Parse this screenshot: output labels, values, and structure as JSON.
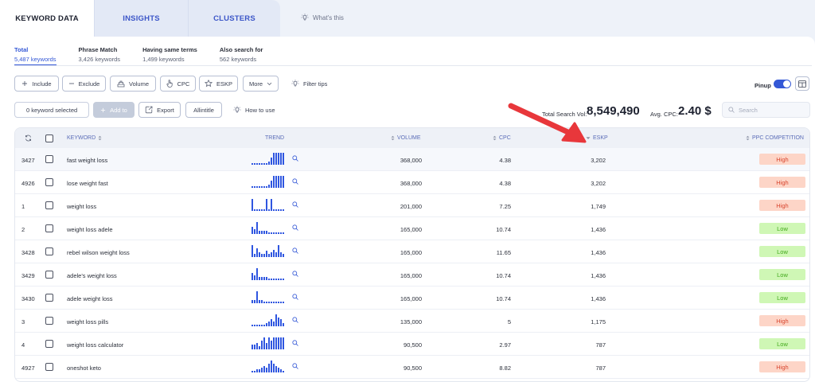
{
  "tabs": [
    {
      "label": "KEYWORD DATA"
    },
    {
      "label": "INSIGHTS"
    },
    {
      "label": "CLUSTERS"
    }
  ],
  "whats_this": "What's this",
  "subtabs": [
    {
      "title": "Total",
      "count": "5,487 keywords"
    },
    {
      "title": "Phrase Match",
      "count": "3,426 keywords"
    },
    {
      "title": "Having same terms",
      "count": "1,499 keywords"
    },
    {
      "title": "Also search for",
      "count": "562 keywords"
    }
  ],
  "filters": {
    "include": "Include",
    "exclude": "Exclude",
    "volume": "Volume",
    "cpc": "CPC",
    "eskp": "ESKP",
    "more": "More",
    "filter_tips": "Filter tips"
  },
  "pinup": {
    "label": "Pinup",
    "on": true
  },
  "actions": {
    "selected": "0 keyword selected",
    "add_to": "Add to",
    "export": "Export",
    "allintitle": "Allintitle",
    "how_to_use": "How to use"
  },
  "stats": {
    "total_label": "Total Search Vol:",
    "total_value": "8,549,490",
    "cpc_label": "Avg. CPC:",
    "cpc_value": "2.40 $"
  },
  "search": {
    "placeholder": "Search"
  },
  "table": {
    "headers": {
      "keyword": "KEYWORD",
      "trend": "TREND",
      "volume": "VOLUME",
      "cpc": "CPC",
      "eskp": "ESKP",
      "competition": "PPC COMPETITION"
    },
    "rows": [
      {
        "id": "3427",
        "keyword": "fast weight loss",
        "volume": "368,000",
        "cpc": "4.38",
        "eskp": "3,202",
        "competition": "High",
        "level": "high",
        "trend": [
          1,
          1,
          1,
          1,
          1,
          1,
          1,
          2,
          5,
          8,
          8,
          8,
          8,
          8
        ]
      },
      {
        "id": "4926",
        "keyword": "lose weight fast",
        "volume": "368,000",
        "cpc": "4.38",
        "eskp": "3,202",
        "competition": "High",
        "level": "high",
        "trend": [
          1,
          1,
          1,
          1,
          1,
          1,
          1,
          2,
          5,
          8,
          8,
          8,
          8,
          8
        ]
      },
      {
        "id": "1",
        "keyword": "weight loss",
        "volume": "201,000",
        "cpc": "7.25",
        "eskp": "1,749",
        "competition": "High",
        "level": "high",
        "trend": [
          8,
          1,
          1,
          1,
          1,
          1,
          8,
          1,
          8,
          1,
          1,
          1,
          1,
          1
        ]
      },
      {
        "id": "2",
        "keyword": "weight loss adele",
        "volume": "165,000",
        "cpc": "10.74",
        "eskp": "1,436",
        "competition": "Low",
        "level": "low",
        "trend": [
          5,
          3,
          8,
          2,
          2,
          2,
          2,
          1,
          1,
          1,
          1,
          1,
          1,
          1
        ]
      },
      {
        "id": "3428",
        "keyword": "rebel wilson weight loss",
        "volume": "165,000",
        "cpc": "11.65",
        "eskp": "1,436",
        "competition": "Low",
        "level": "low",
        "trend": [
          8,
          2,
          6,
          3,
          2,
          2,
          4,
          2,
          3,
          5,
          3,
          8,
          3,
          2
        ]
      },
      {
        "id": "3429",
        "keyword": "adele's weight loss",
        "volume": "165,000",
        "cpc": "10.74",
        "eskp": "1,436",
        "competition": "Low",
        "level": "low",
        "trend": [
          5,
          3,
          8,
          2,
          2,
          2,
          2,
          1,
          1,
          1,
          1,
          1,
          1,
          1
        ]
      },
      {
        "id": "3430",
        "keyword": "adele weight loss",
        "volume": "165,000",
        "cpc": "10.74",
        "eskp": "1,436",
        "competition": "Low",
        "level": "low",
        "trend": [
          2,
          2,
          8,
          2,
          2,
          1,
          1,
          1,
          1,
          1,
          1,
          1,
          1,
          1
        ]
      },
      {
        "id": "3",
        "keyword": "weight loss pills",
        "volume": "135,000",
        "cpc": "5",
        "eskp": "1,175",
        "competition": "High",
        "level": "high",
        "trend": [
          1,
          1,
          1,
          1,
          1,
          1,
          2,
          3,
          5,
          3,
          8,
          6,
          5,
          2
        ]
      },
      {
        "id": "4",
        "keyword": "weight loss calculator",
        "volume": "90,500",
        "cpc": "2.97",
        "eskp": "787",
        "competition": "Low",
        "level": "low",
        "trend": [
          3,
          3,
          4,
          2,
          6,
          8,
          4,
          8,
          6,
          8,
          8,
          8,
          8,
          8
        ]
      },
      {
        "id": "4927",
        "keyword": "oneshot keto",
        "volume": "90,500",
        "cpc": "8.82",
        "eskp": "787",
        "competition": "High",
        "level": "high",
        "trend": [
          1,
          1,
          2,
          2,
          3,
          4,
          3,
          6,
          8,
          6,
          4,
          3,
          2,
          1
        ]
      }
    ]
  },
  "colors": {
    "accent": "#3458d6",
    "high_bg": "#fdd5c7",
    "low_bg": "#cff7b5",
    "annotation_arrow": "#e8373b"
  }
}
